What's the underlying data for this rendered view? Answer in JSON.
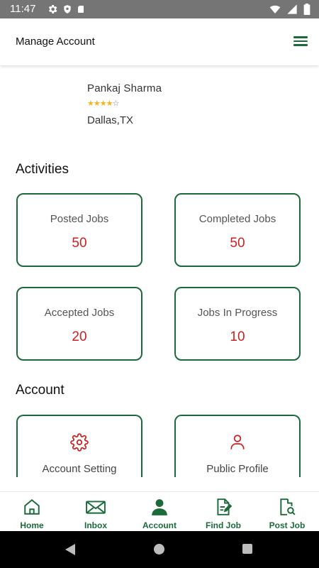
{
  "status_bar": {
    "time": "11:47"
  },
  "app_bar": {
    "title": "Manage Account"
  },
  "profile": {
    "name": "Pankaj Sharma",
    "rating": 4,
    "rating_max": 5,
    "location": "Dallas,TX"
  },
  "activities": {
    "title": "Activities",
    "cards": [
      {
        "label": "Posted Jobs",
        "value": "50"
      },
      {
        "label": "Completed Jobs",
        "value": "50"
      },
      {
        "label": "Accepted Jobs",
        "value": "20"
      },
      {
        "label": "Jobs In Progress",
        "value": "10"
      }
    ]
  },
  "account": {
    "title": "Account",
    "cards": [
      {
        "label": "Account Setting",
        "icon": "gear-icon"
      },
      {
        "label": "Public Profile",
        "icon": "user-icon"
      }
    ]
  },
  "bottom_nav": {
    "items": [
      {
        "label": "Home",
        "icon": "home-icon"
      },
      {
        "label": "Inbox",
        "icon": "mail-icon"
      },
      {
        "label": "Account",
        "icon": "person-icon"
      },
      {
        "label": "Find Job",
        "icon": "edit-document-icon"
      },
      {
        "label": "Post Job",
        "icon": "search-document-icon"
      }
    ]
  },
  "colors": {
    "brand_green": "#1b6b3a",
    "value_red": "#cc1f1f",
    "star_yellow": "#f2b41a",
    "status_bar": "#757575"
  }
}
